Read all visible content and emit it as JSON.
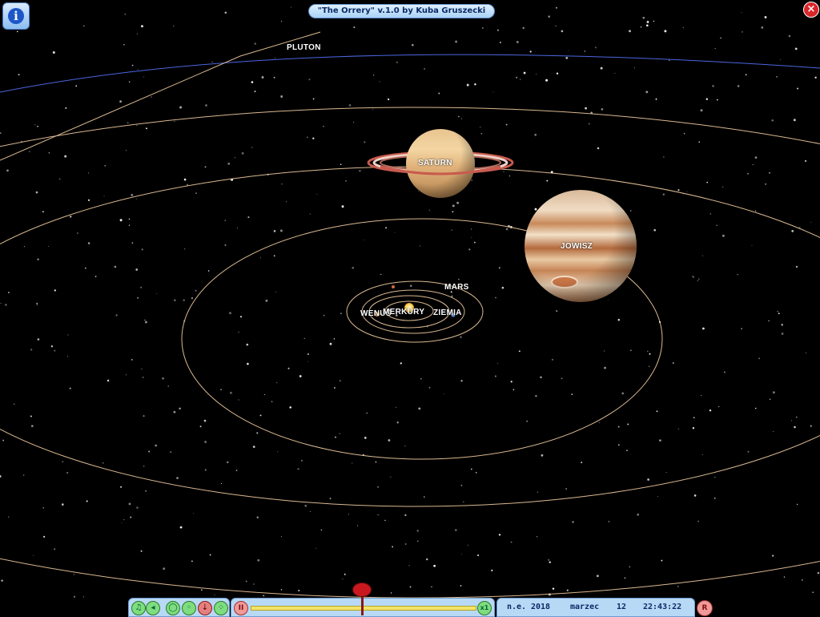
{
  "app": {
    "title": "\"The Orrery\" v.1.0 by Kuba Gruszecki"
  },
  "controls": {
    "info_icon": "info-icon",
    "close_icon": "close-icon",
    "pause_label": "II",
    "speed_x1_label": "x1",
    "reset_label": "R"
  },
  "planets": {
    "pluton": "PLUTON",
    "saturn": "SATURN",
    "jowisz": "JOWISZ",
    "mars": "MARS",
    "wenus": "WENUS",
    "merkury": "MERKURY",
    "ziemia": "ZIEMIA"
  },
  "date": {
    "era": "n.e.",
    "year": "2018",
    "month": "marzec",
    "day": "12",
    "time": "22:43:22"
  },
  "toolbar": {
    "buttons": [
      "music-icon",
      "sound-icon",
      "orbit-icon",
      "zoom-icon",
      "pointer-icon",
      "stars-icon"
    ]
  },
  "colors": {
    "background": "#000000",
    "panel": "#b8d9f5",
    "orbit": "#d9b890",
    "pluto_orbit": "#4a66e0",
    "accent_red": "#c9191f"
  }
}
